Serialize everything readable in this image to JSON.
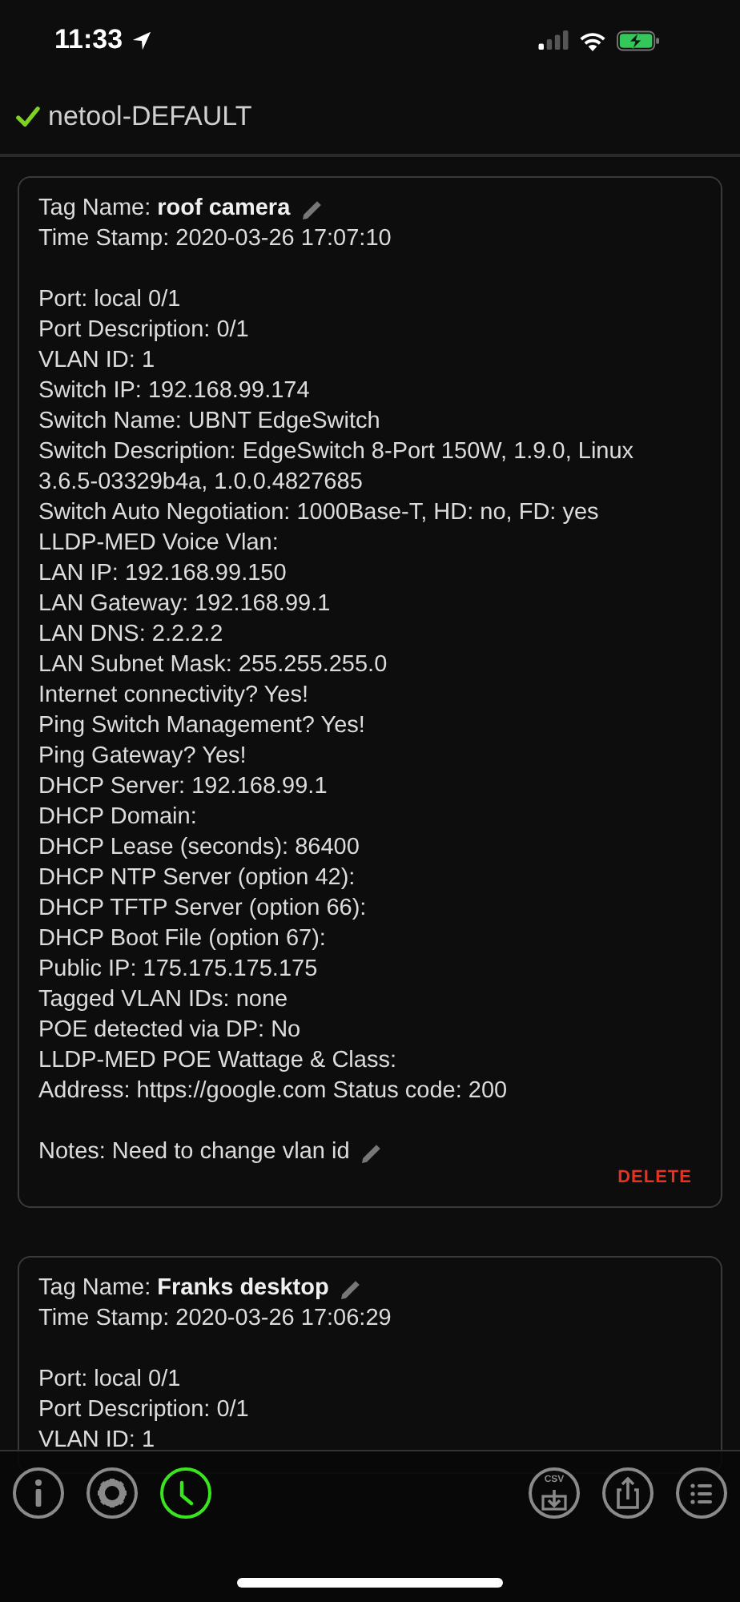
{
  "status_bar": {
    "time": "11:33"
  },
  "header": {
    "title": "netool-DEFAULT",
    "ok": true
  },
  "cards": [
    {
      "tag_label": "Tag Name:",
      "tag_name": "roof camera",
      "timestamp": "Time Stamp: 2020-03-26 17:07:10",
      "details": [
        "Port: local 0/1",
        "Port Description: 0/1",
        "VLAN ID: 1",
        "Switch IP: 192.168.99.174",
        "Switch Name: UBNT EdgeSwitch",
        "Switch Description: EdgeSwitch 8-Port 150W, 1.9.0, Linux 3.6.5-03329b4a, 1.0.0.4827685",
        "Switch Auto Negotiation: 1000Base-T, HD: no, FD: yes",
        "LLDP-MED Voice Vlan:",
        "LAN IP: 192.168.99.150",
        "LAN Gateway: 192.168.99.1",
        "LAN DNS: 2.2.2.2",
        "LAN Subnet Mask: 255.255.255.0",
        "Internet connectivity? Yes!",
        "Ping Switch Management? Yes!",
        "Ping Gateway? Yes!",
        "DHCP Server: 192.168.99.1",
        "DHCP Domain:",
        "DHCP Lease (seconds): 86400",
        "DHCP NTP Server (option 42):",
        "DHCP TFTP Server (option 66):",
        "DHCP Boot File (option 67):",
        "Public IP: 175.175.175.175",
        "Tagged VLAN IDs: none",
        "POE detected via DP: No",
        "LLDP-MED POE Wattage & Class:",
        "Address: https://google.com Status code: 200"
      ],
      "notes": "Notes: Need to change vlan id",
      "delete": "DELETE"
    },
    {
      "tag_label": "Tag Name:",
      "tag_name": "Franks desktop",
      "timestamp": "Time Stamp: 2020-03-26 17:06:29",
      "details": [
        "Port: local 0/1",
        "Port Description: 0/1",
        "VLAN ID: 1"
      ]
    }
  ],
  "toolbar": [
    {
      "kind": "info",
      "selected": false
    },
    {
      "kind": "settings",
      "selected": false
    },
    {
      "kind": "history",
      "selected": true
    },
    {
      "kind": "csv",
      "label": "CSV",
      "selected": false
    },
    {
      "kind": "share",
      "selected": false
    },
    {
      "kind": "list",
      "selected": false
    }
  ]
}
